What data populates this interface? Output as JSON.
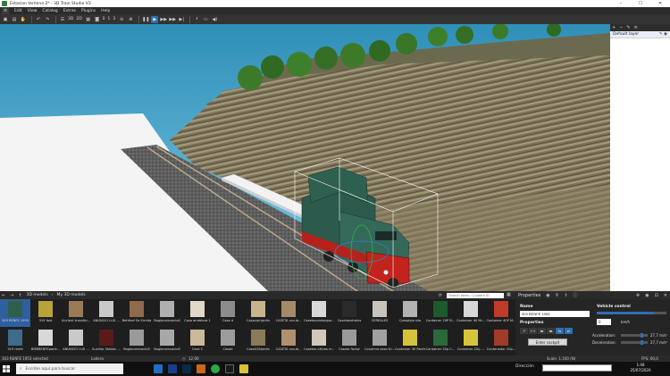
{
  "window": {
    "title": "Estacion termino 2* - 3D Train Studio V3",
    "controls": [
      "–",
      "☐",
      "✕"
    ]
  },
  "menu": {
    "hamburger": "≡",
    "items": [
      "Edit",
      "View",
      "Catalog",
      "Extras",
      "Plugins",
      "Help"
    ]
  },
  "toolbar": {
    "view_3d": "3D",
    "view_2d": "2D",
    "counter_a": "0",
    "counter_b": "1",
    "counter_c": "3"
  },
  "layers_panel": {
    "layer_name": "Default layer"
  },
  "library": {
    "breadcrumb_root": "3D models",
    "breadcrumb_current": "My 3D models",
    "search_placeholder": "Search items / Content ID",
    "items_row1": [
      {
        "label": "303 RENFE 1953",
        "icon": "locomotive-icon",
        "color": "#2f5f4a"
      },
      {
        "label": "319 fast",
        "icon": "locomotive-icon",
        "color": "#b8a23a"
      },
      {
        "label": "Ancient transfor...",
        "icon": "building-icon",
        "color": "#9a7b55"
      },
      {
        "label": "ANUNCIO LUX ...",
        "icon": "sign-icon",
        "color": "#c9c9c9"
      },
      {
        "label": "Behthof Se Ermita",
        "icon": "building-icon",
        "color": "#8e6b4a"
      },
      {
        "label": "Bogiecomvacio4",
        "icon": "wagon-icon",
        "color": "#b0b0b0"
      },
      {
        "label": "Casa andaluza 1",
        "icon": "building-icon",
        "color": "#e0d8c8"
      },
      {
        "label": "Casa d",
        "icon": "building-icon",
        "color": "#8c8c8c"
      },
      {
        "label": "Casacorrjardin",
        "icon": "building-icon",
        "color": "#c8b48a"
      },
      {
        "label": "CASETA rucub...",
        "icon": "building-icon",
        "color": "#a38a6a"
      },
      {
        "label": "Casetacombequa...",
        "icon": "building-icon",
        "color": "#d8d8d8"
      },
      {
        "label": "Casetaestrales",
        "icon": "building-icon",
        "color": "#2a2a2a"
      },
      {
        "label": "CEREALES",
        "icon": "silo-icon",
        "color": "#c9c4bb"
      },
      {
        "label": "Complejo silo",
        "icon": "silo-icon",
        "color": "#b3b3b3"
      },
      {
        "label": "Container 20P B...",
        "icon": "container-icon",
        "color": "#1d5a2c"
      },
      {
        "label": "Container 40 Mi...",
        "icon": "container-icon",
        "color": "#d8d8d8"
      },
      {
        "label": "Container 40P M...",
        "icon": "container-icon",
        "color": "#c23a2a"
      }
    ],
    "items_row2": [
      {
        "label": "319 renfe",
        "icon": "locomotive-icon",
        "color": "#3f6a8a"
      },
      {
        "label": "BMBRENFEpane...",
        "icon": "wagon-icon",
        "color": "#d8d8d8"
      },
      {
        "label": "ANUNCIO LUX ...",
        "icon": "sign-icon",
        "color": "#c9c9c9"
      },
      {
        "label": "Auxiliar Station ...",
        "icon": "wagon-icon",
        "color": "#5a1a1a"
      },
      {
        "label": "Bogiecomvacio3",
        "icon": "wagon-icon",
        "color": "#9a9a9a"
      },
      {
        "label": "Bogiecomvacio5",
        "icon": "wagon-icon",
        "color": "#a8a8a8"
      },
      {
        "label": "Casa C",
        "icon": "building-icon",
        "color": "#c9b89a"
      },
      {
        "label": "Casab",
        "icon": "building-icon",
        "color": "#9c9c9c"
      },
      {
        "label": "Casa028jardin",
        "icon": "building-icon",
        "color": "#8a7a5a"
      },
      {
        "label": "CASETA rucub...",
        "icon": "building-icon",
        "color": "#b09070"
      },
      {
        "label": "Casetas oficios m...",
        "icon": "building-icon",
        "color": "#d0c8b8"
      },
      {
        "label": "Caseta factor",
        "icon": "building-icon",
        "color": "#9a9a9a"
      },
      {
        "label": "Columna vaso tri...",
        "icon": "column-icon",
        "color": "#a0a0a0"
      },
      {
        "label": "Container 30 Renfe",
        "icon": "container-icon",
        "color": "#d4c23a"
      },
      {
        "label": "Container 20p C...",
        "icon": "container-icon",
        "color": "#2a6a3a"
      },
      {
        "label": "Container 20p ...",
        "icon": "container-icon",
        "color": "#d8c43a"
      },
      {
        "label": "Contenedor 20p...",
        "icon": "container-icon",
        "color": "#a23a2a"
      }
    ]
  },
  "properties": {
    "tab_label": "Properties",
    "name_label": "Name",
    "name_value": "303 RENFE 1953",
    "props_label": "Properties",
    "icons": [
      "↗",
      "⟷",
      "▬",
      "▬",
      "⇆",
      "⇄"
    ],
    "enter_button": "Enter cockpit"
  },
  "vehicle_control": {
    "title": "Vehicle control",
    "speed_value": "0",
    "speed_unit": "km/h",
    "speed_fraction": 0.82,
    "acceleration_label": "Acceleration:",
    "acceleration_value": "27,7 m/s²",
    "deceleration_label": "Deceleration:",
    "deceleration_value": "27,7 m/s²"
  },
  "status": {
    "selected": "303 RENFE 1953 selected",
    "terrain": "Ladera",
    "time": "12:00",
    "scale": "Scale: 1:160 (N)",
    "fps": "FPS: 60,0"
  },
  "taskbar": {
    "search_placeholder": "Escribe aquí para buscar",
    "direction_label": "Dirección",
    "clock_time": "1:48",
    "clock_date": "25/07/2020"
  }
}
